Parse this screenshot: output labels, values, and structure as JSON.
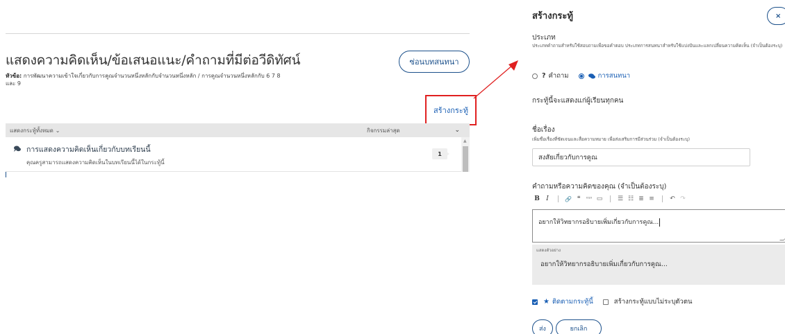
{
  "discussion": {
    "title": "แสดงความคิดเห็น/ข้อเสนอแนะ/คำถามที่มีต่อวีดิทัศน์",
    "topic_label": "หัวข้อ:",
    "topic_text": "การพัฒนาความเข้าใจเกี่ยวกับการคูณจำนวนหนึ่งหลักกับจำนวนหนึ่งหลัก / การคูณจำนวนหนึ่งหลักกับ 6 7 8 และ 9",
    "hide_button": "ซ่อนบทสนทนา",
    "create_post_link": "สร้างกระทู้",
    "list_header": {
      "filter": "แสดงกระทู้ทั้งหมด",
      "sort": "กิจกรรมล่าสุด"
    },
    "threads": [
      {
        "title": "การแสดงความคิดเห็นเกี่ยวกับบทเรียนนี้",
        "subtitle": "คุณครูสามารถแสดงความคิดเห็นในบทเรียนนี้ได้ในกระทู้นี้",
        "count": "1",
        "icon": "discussion-icon"
      }
    ]
  },
  "form": {
    "title": "สร้างกระทู้",
    "close_label": "×",
    "type_label": "ประเภท",
    "type_help": "ประเภทคำถามสำหรับใช้สอบถามเพื่อขอคำตอบ ประเภทการสนทนาสำหรับใช้แบ่งปันและแลกเปลี่ยนความคิดเห็น (จำเป็นต้องระบุ)",
    "type_options": [
      {
        "label": "คำถาม",
        "prefix": "?",
        "selected": false
      },
      {
        "label": "การสนทนา",
        "selected": true,
        "icon": "discussion-icon"
      }
    ],
    "visibility_text": "กระทู้นี้จะแสดงแก่ผู้เรียนทุกคน",
    "subject_label": "ชื่อเรื่อง",
    "subject_help": "เพิ่มชื่อเรื่องที่ชัดเจนและสื่อความหมาย เพื่อส่งเสริมการมีส่วนร่วม (จำเป็นต้องระบุ)",
    "subject_value": "สงสัยเกี่ยวกับการคูณ",
    "body_label": "คำถามหรือความคิดของคุณ (จำเป็นต้องระบุ)",
    "toolbar": {
      "bold": "B",
      "italic": "I",
      "link": "🔗",
      "quote": "❝",
      "code": "⁰¹⁰",
      "image": "▭",
      "numbered_list": "☰",
      "bullet_list": "☷",
      "heading": "≣",
      "hr": "≡",
      "undo": "↶",
      "redo": "↷"
    },
    "body_value": "อยากให้วิทยากรอธิบายเพิ่มเกี่ยวกับการคูณ...",
    "preview_label": "แสดงตัวอย่าง",
    "preview_text": "อยากให้วิทยากรอธิบายเพิ่มเกี่ยวกับการคูณ...",
    "follow_label": "ติดตามกระทู้นี้",
    "follow_checked": true,
    "anonymous_label": "สร้างกระทู้แบบไม่ระบุตัวตน",
    "anonymous_checked": false,
    "post_button": "ส่ง",
    "cancel_button": "ยกเลิก"
  },
  "colors": {
    "accent": "#1a5fb4",
    "border_accent": "#1a4f8a",
    "highlight": "#e02020"
  }
}
